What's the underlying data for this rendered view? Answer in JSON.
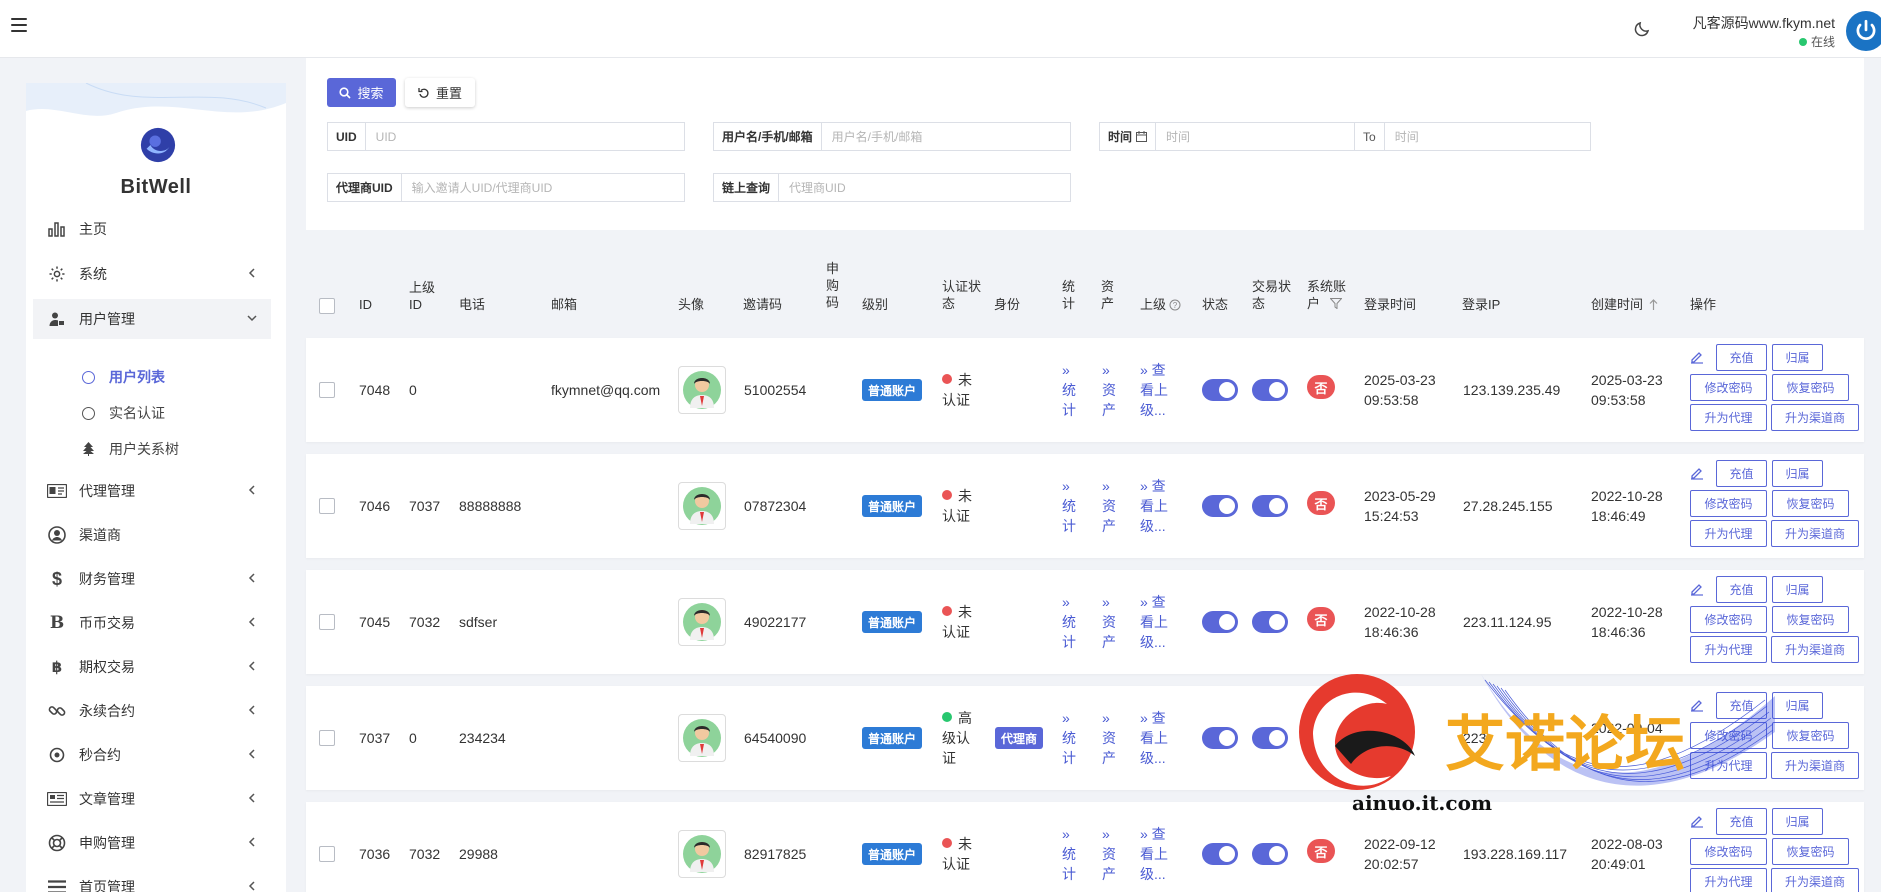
{
  "header": {
    "user_name": "凡客源码www.fkym.net",
    "status": "在线"
  },
  "sidebar": {
    "brand": "BitWell",
    "items": [
      {
        "label": "主页",
        "icon": "bar-chart-icon"
      },
      {
        "label": "系统",
        "icon": "gear-icon"
      },
      {
        "label": "用户管理",
        "icon": "user-lock-icon"
      },
      {
        "label": "代理管理",
        "icon": "id-card-icon"
      },
      {
        "label": "渠道商",
        "icon": "user-circle-icon"
      },
      {
        "label": "财务管理",
        "icon": "dollar-icon"
      },
      {
        "label": "币币交易",
        "icon": "bitcoin-b-icon"
      },
      {
        "label": "期权交易",
        "icon": "bitcoin-icon"
      },
      {
        "label": "永续合约",
        "icon": "link-icon"
      },
      {
        "label": "秒合约",
        "icon": "dot-circle-icon"
      },
      {
        "label": "文章管理",
        "icon": "newspaper-icon"
      },
      {
        "label": "申购管理",
        "icon": "life-ring-icon"
      },
      {
        "label": "首页管理",
        "icon": "bars-icon"
      }
    ],
    "sub_items": [
      {
        "label": "用户列表"
      },
      {
        "label": "实名认证"
      },
      {
        "label": "用户关系树"
      }
    ]
  },
  "filters": {
    "search_label": "搜索",
    "reset_label": "重置",
    "uid_label": "UID",
    "uid_placeholder": "UID",
    "name_label": "用户名/手机/邮箱",
    "name_placeholder": "用户名/手机/邮箱",
    "time_label": "时间",
    "time_placeholder": "时间",
    "to_label": "To",
    "time_to_placeholder": "时间",
    "agent_label": "代理商UID",
    "agent_placeholder": "输入邀请人UID/代理商UID",
    "chain_label": "链上查询",
    "chain_placeholder": "代理商UID"
  },
  "table": {
    "headers": {
      "id": "ID",
      "parent_id_1": "上级",
      "parent_id_2": "ID",
      "phone": "电话",
      "email": "邮箱",
      "avatar": "头像",
      "invite": "邀请码",
      "apply_1": "申",
      "apply_2": "购",
      "apply_3": "码",
      "level": "级别",
      "auth_1": "认证状",
      "auth_2": "态",
      "identity": "身份",
      "stats_1": "统",
      "stats_2": "计",
      "assets_1": "资",
      "assets_2": "产",
      "parent": "上级",
      "status": "状态",
      "trade_1": "交易状",
      "trade_2": "态",
      "sys_1": "系统账",
      "sys_2": "户",
      "login_time": "登录时间",
      "login_ip": "登录IP",
      "created": "创建时间",
      "actions": "操作"
    },
    "rows": [
      {
        "id": "7048",
        "parent_id": "0",
        "phone": "",
        "email": "fkymnet@qq.com",
        "invite": "51002554",
        "level": "普通账户",
        "auth_1": "未",
        "auth_2": "认证",
        "auth_color": "#ea5455",
        "identity": "",
        "login_1": "2025-03-23",
        "login_2": "09:53:58",
        "ip": "123.139.235.49",
        "created_1": "2025-03-23",
        "created_2": "09:53:58"
      },
      {
        "id": "7046",
        "parent_id": "7037",
        "phone": "88888888",
        "email": "",
        "invite": "07872304",
        "level": "普通账户",
        "auth_1": "未",
        "auth_2": "认证",
        "auth_color": "#ea5455",
        "identity": "",
        "login_1": "2023-05-29",
        "login_2": "15:24:53",
        "ip": "27.28.245.155",
        "created_1": "2022-10-28",
        "created_2": "18:46:49"
      },
      {
        "id": "7045",
        "parent_id": "7032",
        "phone": "sdfser",
        "email": "",
        "invite": "49022177",
        "level": "普通账户",
        "auth_1": "未",
        "auth_2": "认证",
        "auth_color": "#ea5455",
        "identity": "",
        "login_1": "2022-10-28",
        "login_2": "18:46:36",
        "ip": "223.11.124.95",
        "created_1": "2022-10-28",
        "created_2": "18:46:36"
      },
      {
        "id": "7037",
        "parent_id": "0",
        "phone": "234234",
        "email": "",
        "invite": "64540090",
        "level": "普通账户",
        "auth_1": "高",
        "auth_2": "级认",
        "auth_3": "证",
        "auth_color": "#28c76f",
        "identity": "代理商",
        "login_1": "2023-3",
        "login_2": "",
        "ip": "223.",
        "created_1": "2022-09-04",
        "created_2": ""
      },
      {
        "id": "7036",
        "parent_id": "7032",
        "phone": "29988",
        "email": "",
        "invite": "82917825",
        "level": "普通账户",
        "auth_1": "未",
        "auth_2": "认证",
        "auth_color": "#ea5455",
        "identity": "",
        "login_1": "2022-09-12",
        "login_2": "20:02:57",
        "ip": "193.228.169.117",
        "created_1": "2022-08-03",
        "created_2": "20:49:01"
      }
    ],
    "cell_text": {
      "stats_1": "»",
      "stats_2": "统",
      "stats_3": "计",
      "assets_1": "»",
      "assets_2": "资",
      "assets_3": "产",
      "parent_1": "» 查",
      "parent_2": "看上",
      "parent_3": "级...",
      "sys_no": "否"
    },
    "actions": {
      "recharge": "充值",
      "belong": "归属",
      "change_pwd": "修改密码",
      "restore_pwd": "恢复密码",
      "to_agent": "升为代理",
      "to_channel": "升为渠道商"
    }
  },
  "watermark": {
    "text": "艾诺论坛",
    "url": "ainuo.it.com"
  },
  "colors": {
    "primary": "#5a67d8",
    "badge": "#2d7bd6",
    "danger": "#ea5455",
    "success": "#28c76f"
  }
}
